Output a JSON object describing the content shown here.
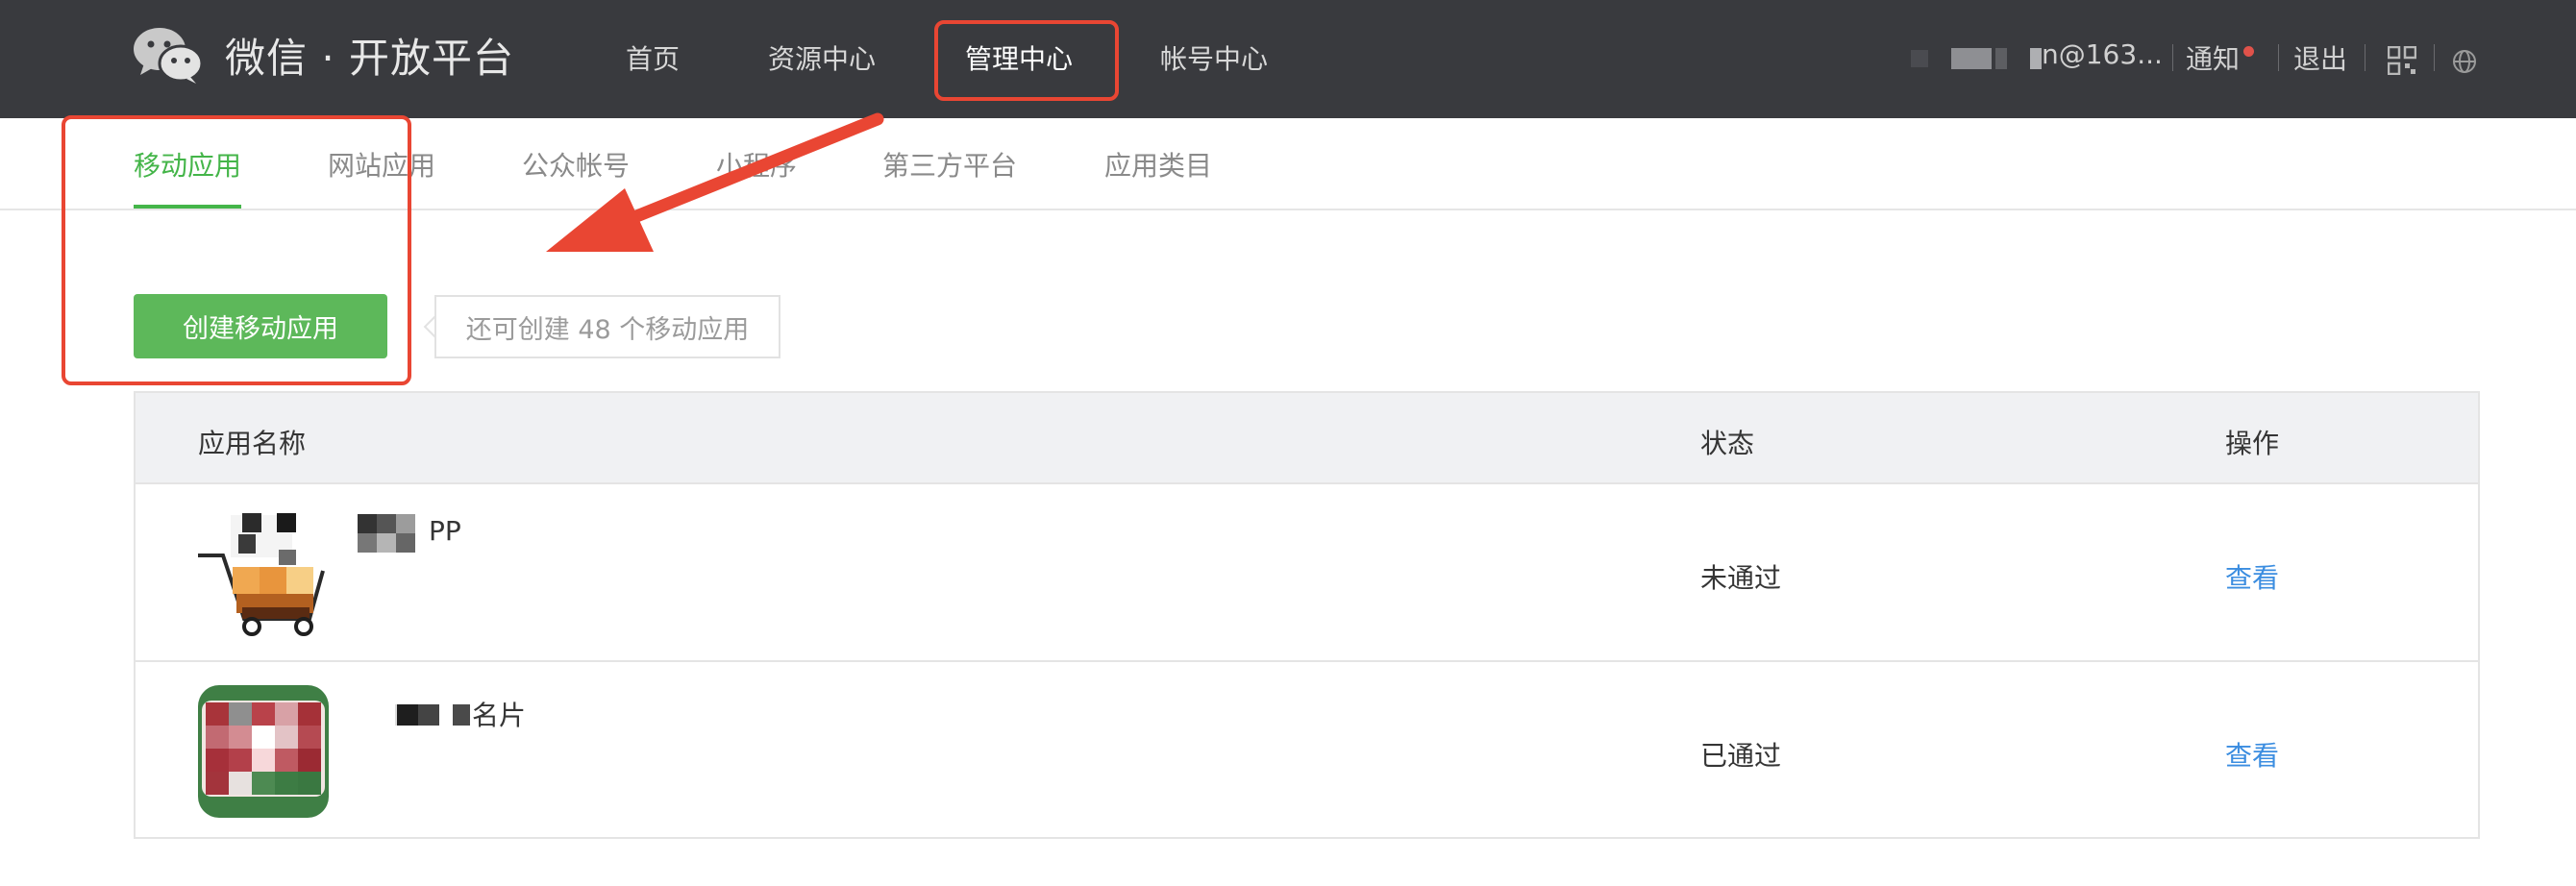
{
  "header": {
    "logo_text": "微信 · 开放平台",
    "nav": [
      "首页",
      "资源中心",
      "管理中心",
      "帐号中心"
    ],
    "active_nav": "管理中心",
    "account": "n@163...",
    "notice": "通知",
    "logout": "退出"
  },
  "subtabs": {
    "items": [
      "移动应用",
      "网站应用",
      "公众帐号",
      "小程序",
      "第三方平台",
      "应用类目"
    ],
    "active": "移动应用"
  },
  "actions": {
    "create_button": "创建移动应用",
    "quota_text": "还可创建 48 个移动应用"
  },
  "table": {
    "columns": [
      "应用名称",
      "状态",
      "操作"
    ],
    "rows": [
      {
        "name": "PP",
        "status": "未通过",
        "action": "查看"
      },
      {
        "name": "名片",
        "status": "已通过",
        "action": "查看"
      }
    ]
  },
  "colors": {
    "topbar": "#393a3e",
    "accent_green": "#44b549",
    "button_green": "#5db85a",
    "link_blue": "#3b8de0",
    "annotation_red": "#e94633"
  },
  "icons": [
    "wechat-logo-icon",
    "qrcode-icon",
    "globe-icon",
    "notice-dot-icon"
  ]
}
